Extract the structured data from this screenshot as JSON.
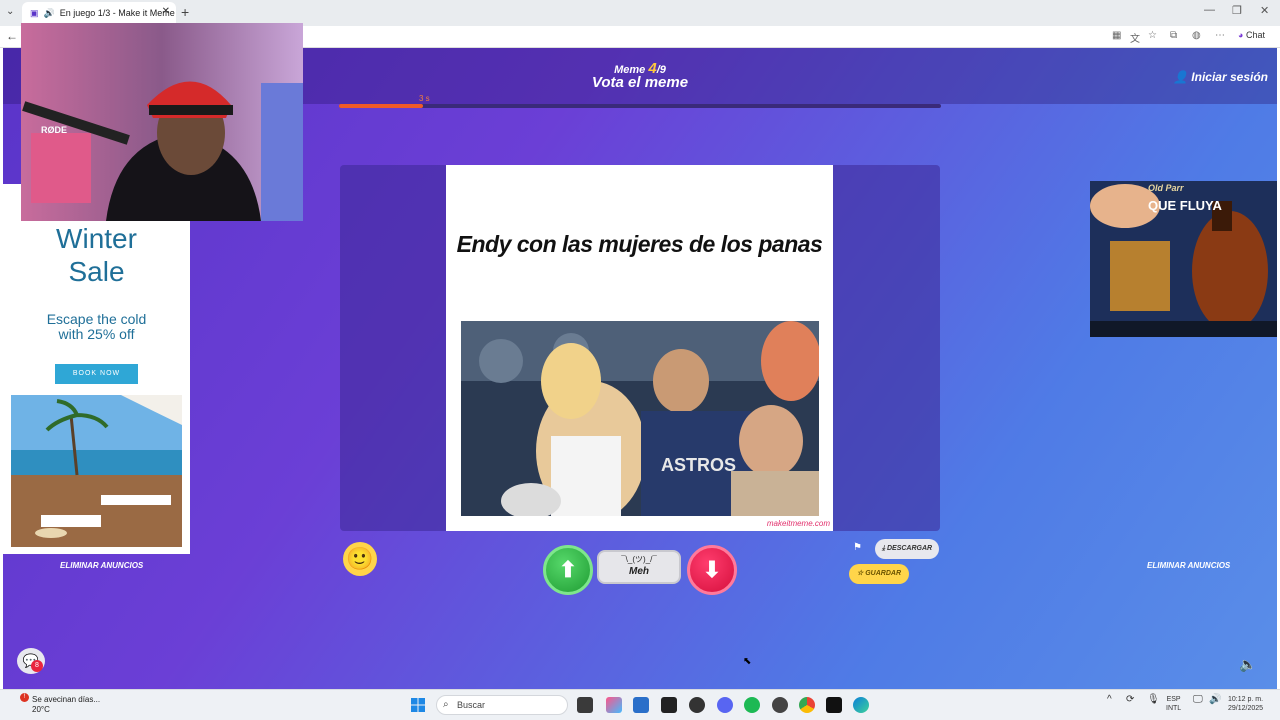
{
  "browser": {
    "tab_title": "En juego 1/3 - Make it Meme",
    "new_tab": "+",
    "tab_close": "✕",
    "chat_label": "Chat"
  },
  "header": {
    "round_prefix": "Meme",
    "round_current": "4",
    "round_total": "/9",
    "title": "Vota el meme",
    "login": "Iniciar sesión"
  },
  "timer": {
    "label": "3 s",
    "remaining_fraction": 0.14
  },
  "meme": {
    "caption": "Endy con las mujeres de los panas",
    "watermark": "makeitmeme.com"
  },
  "vote": {
    "meh_symbol": "¯\\_(ツ)_/¯",
    "meh_label": "Meh",
    "up_icon": "arrow-up",
    "down_icon": "arrow-down"
  },
  "actions": {
    "download": "DESCARGAR",
    "save": "GUARDAR"
  },
  "remove_ads_left": "ELIMINAR ANUNCIOS",
  "remove_ads_right": "ELIMINAR ANUNCIOS",
  "chat_badge": "8",
  "ad_left": {
    "title": "Winter Sale",
    "subtitle": "Escape the cold with 25% off",
    "button": "BOOK NOW"
  },
  "ad_right": {
    "brand": "Old Parr",
    "slogan": "QUE FLUYA"
  },
  "taskbar": {
    "weather_title": "Se avecinan días...",
    "weather_temp": "20°C",
    "search_placeholder": "Buscar",
    "lang_top": "ESP",
    "lang_bottom": "INTL",
    "time": "10:12 p. m.",
    "date": "29/12/2025"
  },
  "colors": {
    "accent_orange": "#f05a28",
    "vote_up": "#1f9c33",
    "vote_down": "#d50f3c",
    "gold": "#ffc83d"
  }
}
